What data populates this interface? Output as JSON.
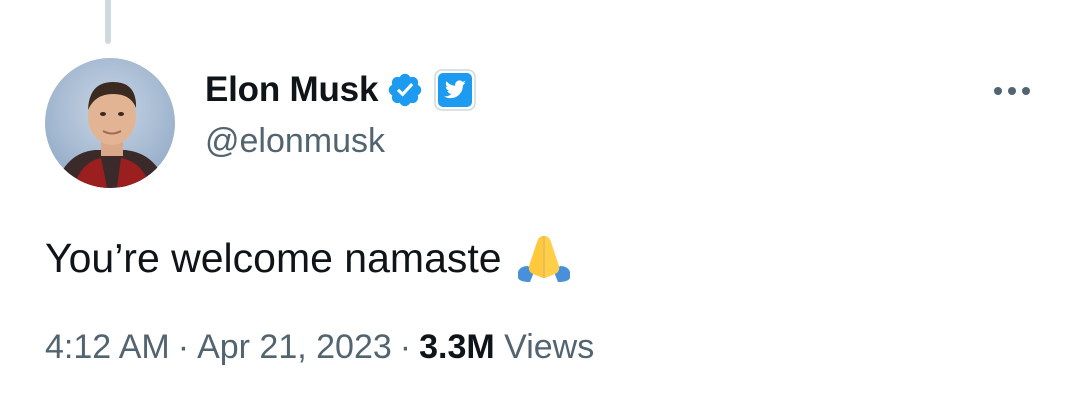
{
  "author": {
    "name": "Elon Musk",
    "handle": "@elonmusk",
    "avatar_icon": "profile-photo",
    "verified_icon": "blue-verified-badge",
    "affiliate_icon": "twitter-bird-badge"
  },
  "tweet": {
    "text": "You’re welcome namaste",
    "emoji_icon": "folded-hands-emoji"
  },
  "meta": {
    "time": "4:12 AM",
    "separator": "·",
    "date": "Apr 21, 2023",
    "views_count": "3.3M",
    "views_label": "Views"
  },
  "actions": {
    "more_icon": "more-options-icon"
  },
  "colors": {
    "accent": "#1d9bf0",
    "secondary_text": "#536471",
    "primary_text": "#0f1419",
    "thread_line": "#cfd9de"
  }
}
